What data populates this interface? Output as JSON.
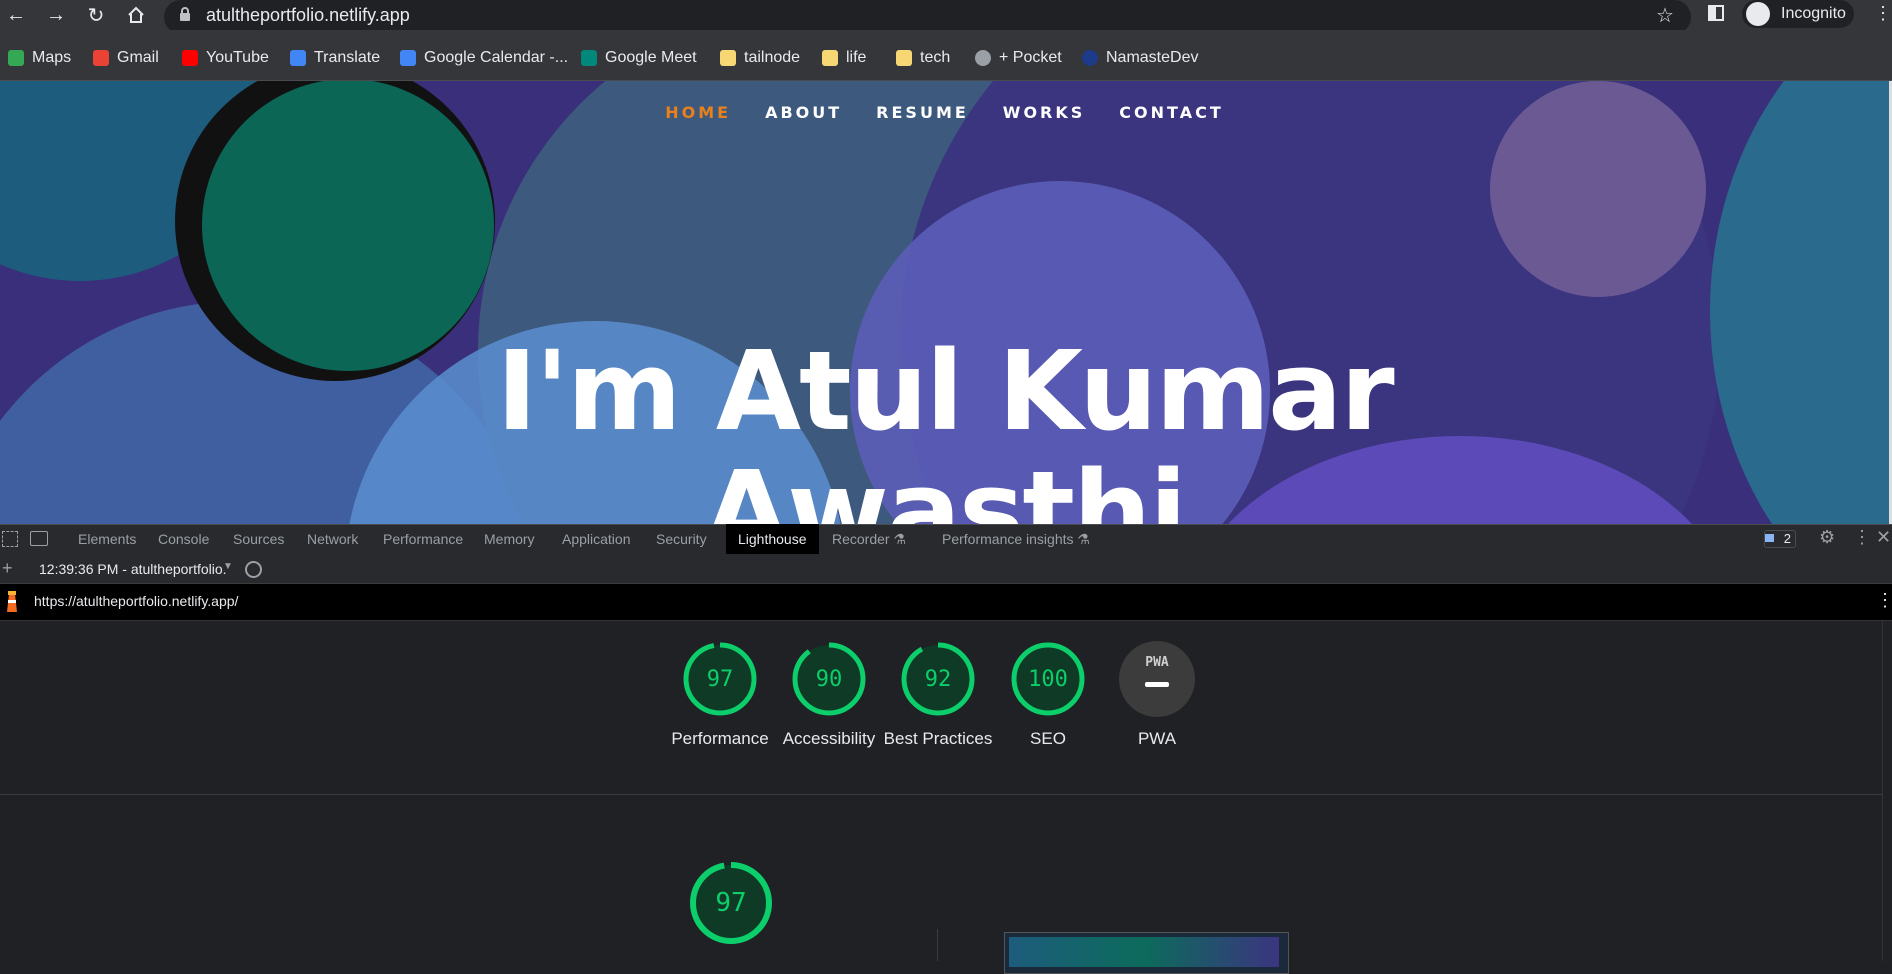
{
  "browser": {
    "url": "atultheportfolio.netlify.app",
    "profile_label": "Incognito"
  },
  "bookmarks": [
    {
      "label": "Maps",
      "icon": "maps-icon",
      "color": "#34a853"
    },
    {
      "label": "Gmail",
      "icon": "gmail-icon",
      "color": "#ea4335"
    },
    {
      "label": "YouTube",
      "icon": "youtube-icon",
      "color": "#ff0000"
    },
    {
      "label": "Translate",
      "icon": "translate-icon",
      "color": "#4285f4"
    },
    {
      "label": "Google Calendar -...",
      "icon": "calendar-icon",
      "color": "#4285f4",
      "badge": "27"
    },
    {
      "label": "Google Meet",
      "icon": "meet-icon",
      "color": "#00897b"
    },
    {
      "label": "tailnode",
      "icon": "folder-icon",
      "color": "#f7d774"
    },
    {
      "label": "life",
      "icon": "folder-icon",
      "color": "#f7d774"
    },
    {
      "label": "tech",
      "icon": "folder-icon",
      "color": "#f7d774"
    },
    {
      "label": "+ Pocket",
      "icon": "globe-icon",
      "color": "#9aa0a6"
    },
    {
      "label": "NamasteDev",
      "icon": "namastedev-icon",
      "color": "#1e3a8a"
    }
  ],
  "site": {
    "nav": [
      "HOME",
      "ABOUT",
      "RESUME",
      "WORKS",
      "CONTACT"
    ],
    "active_nav": "HOME",
    "hero_line1": "I'm Atul Kumar",
    "hero_line2": "Awasthi",
    "accent": "#e9801c"
  },
  "devtools": {
    "tabs": [
      "Elements",
      "Console",
      "Sources",
      "Network",
      "Performance",
      "Memory",
      "Application",
      "Security",
      "Lighthouse",
      "Recorder",
      "Performance insights"
    ],
    "active_tab": "Lighthouse",
    "issues_count": "2",
    "report_selector": "12:39:36 PM - atultheportfolio.",
    "report_url": "https://atultheportfolio.netlify.app/"
  },
  "lighthouse": {
    "scores": [
      {
        "label": "Performance",
        "value": "97",
        "fraction": 0.97
      },
      {
        "label": "Accessibility",
        "value": "90",
        "fraction": 0.9
      },
      {
        "label": "Best Practices",
        "value": "92",
        "fraction": 0.92
      },
      {
        "label": "SEO",
        "value": "100",
        "fraction": 1.0
      },
      {
        "label": "PWA",
        "value": "PWA",
        "fraction": 0
      }
    ],
    "main_score": {
      "value": "97",
      "fraction": 0.97
    },
    "pass_color": "#0cce6b"
  }
}
